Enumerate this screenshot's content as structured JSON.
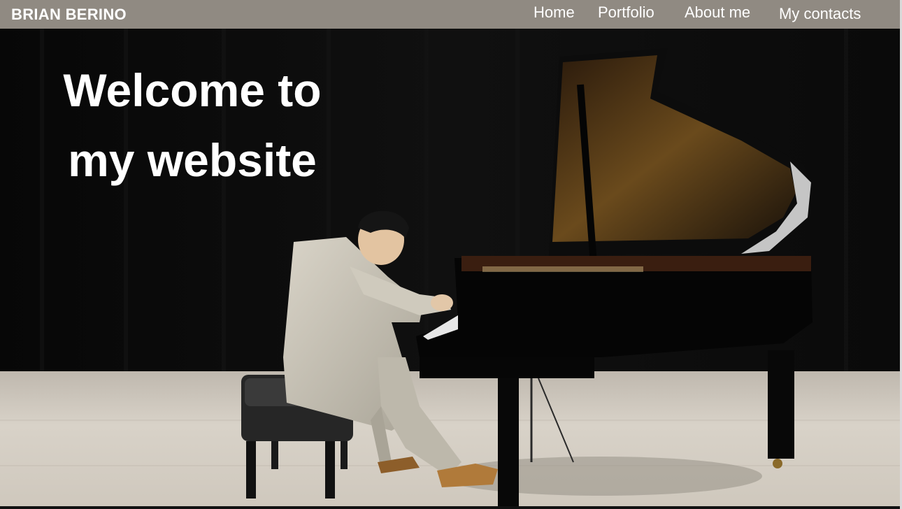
{
  "site": {
    "brand": "BRIAN BERINO"
  },
  "nav": {
    "items": [
      {
        "label": "Home"
      },
      {
        "label": "Portfolio"
      },
      {
        "label": "About me"
      },
      {
        "label": "My contacts"
      }
    ]
  },
  "hero": {
    "headline_line1": "Welcome to",
    "headline_line2": "my website"
  },
  "colors": {
    "navbar": "#908a82",
    "hero_background": "#0b0b0b",
    "text": "#ffffff"
  }
}
